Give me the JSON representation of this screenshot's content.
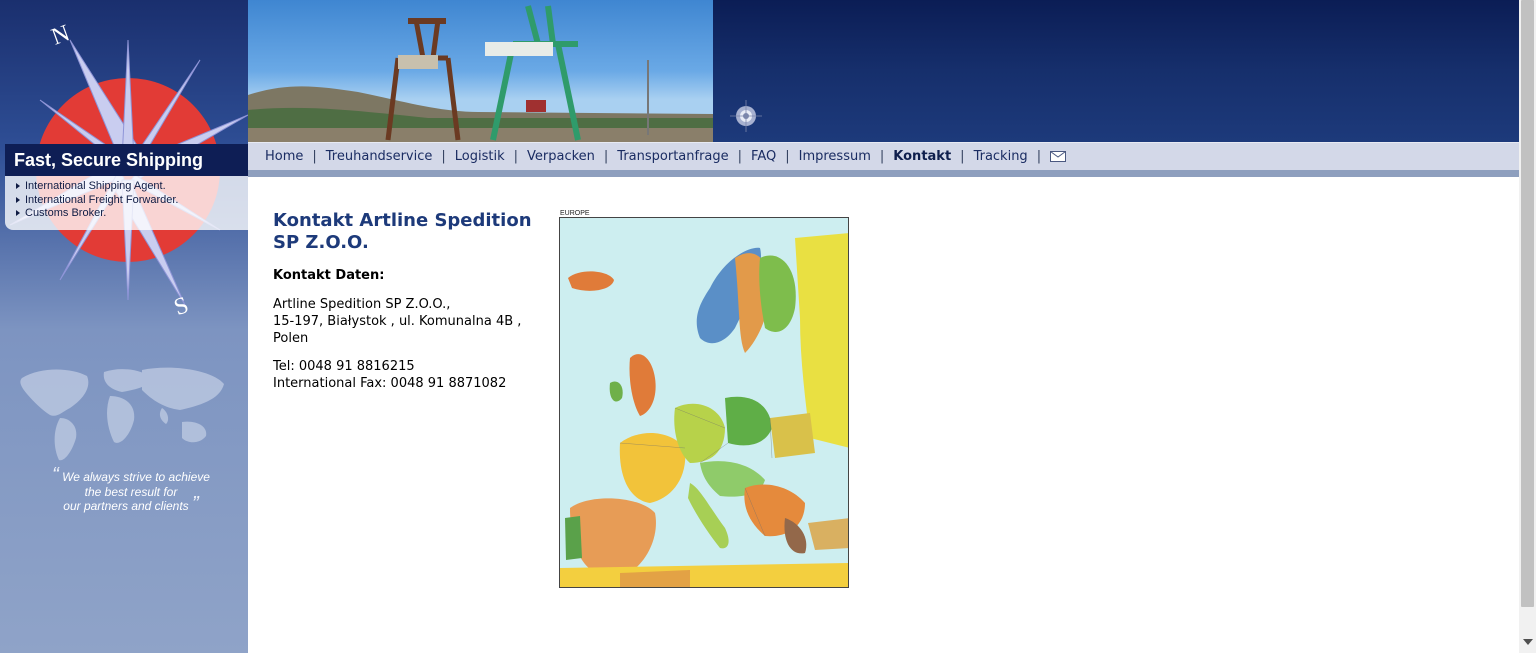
{
  "brand": {
    "title": "Fast, Secure Shipping",
    "services": [
      "International Shipping Agent.",
      "International Freight Forwarder.",
      "Customs Broker."
    ],
    "compass_north": "N",
    "compass_south": "S",
    "slogan_line1": "We always  strive to achieve",
    "slogan_line2": "the best result for",
    "slogan_line3": "our partners and clients"
  },
  "nav": {
    "items": [
      {
        "label": "Home"
      },
      {
        "label": "Treuhandservice"
      },
      {
        "label": "Logistik"
      },
      {
        "label": "Verpacken"
      },
      {
        "label": "Transportanfrage"
      },
      {
        "label": "FAQ"
      },
      {
        "label": "Impressum"
      },
      {
        "label": "Kontakt"
      },
      {
        "label": "Tracking"
      }
    ],
    "separator": "|",
    "mail_icon": "mail-icon"
  },
  "main": {
    "title": "Kontakt Artline Spedition SP Z.O.O.",
    "contact_heading": "Kontakt Daten:",
    "address_line1": "Artline Spedition SP Z.O.O.,",
    "address_line2": "15-197, Białystok , ul. Komunalna 4B ,",
    "address_line3": "Polen",
    "tel": "Tel: 0048 91 8816215",
    "fax": "International Fax: 0048 91 8871082",
    "map_caption": "EUROPE"
  },
  "colors": {
    "sidebar_dark": "#1a2f6e",
    "nav_bg": "#d3d8e8",
    "title_blue": "#1d3a7a",
    "compass_red": "#e23b36"
  }
}
